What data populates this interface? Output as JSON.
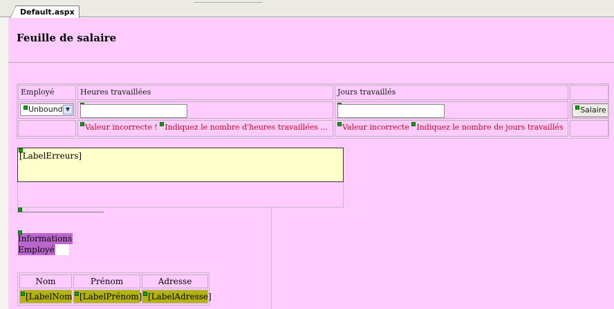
{
  "tabs": [
    {
      "label": "Default.aspx"
    }
  ],
  "page": {
    "title": "Feuille de salaire"
  },
  "grid": {
    "headers": [
      "Employé",
      "Heures travaillées",
      "Jours travaillés",
      ""
    ],
    "employee_select": {
      "value": "Unbound"
    },
    "hours_input": {
      "value": ""
    },
    "days_input": {
      "value": ""
    },
    "salary_button": "Salaire",
    "errors": {
      "hours_invalid": "Valeur incorrecte !",
      "hours_required": "Indiquez le nombre d'heures travaillées ...",
      "days_invalid": "Valeur incorrecte",
      "days_required": "Indiquez le nombre de jours travaillés"
    }
  },
  "label_erreurs": "[LabelErreurs]",
  "info": {
    "line1": "Informations",
    "line2": "Employé"
  },
  "employee_table": {
    "headers": [
      "Nom",
      "Prénom",
      "Adresse"
    ],
    "cells": [
      "[LabelNom]",
      "[LabelPrénom]",
      "[LabelAdresse]"
    ]
  },
  "colors": {
    "design_surface": "#ffccff",
    "error_text": "#e0001a",
    "label_erreurs_bg": "#ffffcc",
    "info_highlight": "#bb66cc",
    "label_cell_bg": "#b3b300"
  }
}
